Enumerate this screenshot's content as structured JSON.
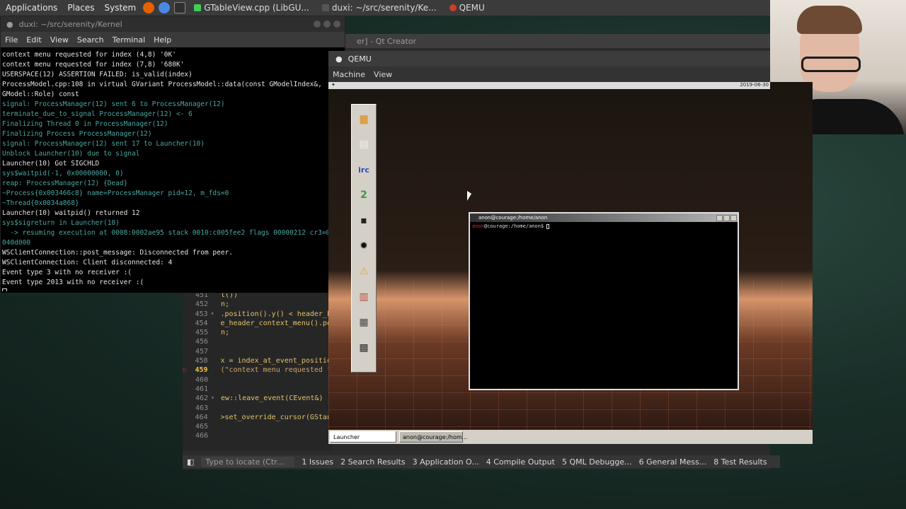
{
  "top_panel": {
    "applications": "Applications",
    "places": "Places",
    "system": "System",
    "tasks": [
      {
        "label": "GTableView.cpp (LibGU..."
      },
      {
        "label": "duxi: ~/src/serenity/Ke..."
      },
      {
        "label": "QEMU"
      }
    ],
    "colors": {
      "firefox": "#e66000",
      "chromium": "#4a88e6",
      "terminal_task": "#2f2f2f"
    }
  },
  "terminal": {
    "title": "duxi: ~/src/serenity/Kernel",
    "menu": [
      "File",
      "Edit",
      "View",
      "Search",
      "Terminal",
      "Help"
    ],
    "lines": [
      {
        "text": "context menu requested for index (4,8) '0K'",
        "style": "white"
      },
      {
        "text": "context menu requested for index (7,8) '680K'",
        "style": "white"
      },
      {
        "text": "USERSPACE(12) ASSERTION FAILED: is_valid(index)",
        "style": "white"
      },
      {
        "text": "ProcessModel.cpp:108 in virtual GVariant ProcessModel::data(const GModelIndex&,",
        "style": "white"
      },
      {
        "text": "GModel::Role) const",
        "style": "white"
      },
      {
        "text": "signal: ProcessManager(12) sent 6 to ProcessManager(12)",
        "style": "cyan"
      },
      {
        "text": "terminate_due_to_signal ProcessManager(12) <- 6",
        "style": "cyan"
      },
      {
        "text": "Finalizing Thread 0 in ProcessManager(12)",
        "style": "cyan"
      },
      {
        "text": "Finalizing Process ProcessManager(12)",
        "style": "cyan"
      },
      {
        "text": "signal: ProcessManager(12) sent 17 to Launcher(10)",
        "style": "cyan"
      },
      {
        "text": "Unblock Launcher(10) due to signal",
        "style": "cyan"
      },
      {
        "text": "Launcher(10) Got SIGCHLD",
        "style": "white"
      },
      {
        "text": "sys$waitpid(-1, 0x00000000, 0)",
        "style": "cyan"
      },
      {
        "text": "reap: ProcessManager(12) {Dead}",
        "style": "cyan"
      },
      {
        "text": "~Process{0x003466c8} name=ProcessManager pid=12, m_fds=0",
        "style": "cyan"
      },
      {
        "text": "~Thread{0x0034a868}",
        "style": "cyan"
      },
      {
        "text": "Launcher(10) waitpid() returned 12",
        "style": "white"
      },
      {
        "text": "sys$sigreturn in Launcher(10)",
        "style": "cyan"
      },
      {
        "text": "  -> resuming execution at 0008:0002ae95 stack 0010:c005fee2 flags 00000212 cr3=0",
        "style": "cyan"
      },
      {
        "text": "040d000",
        "style": "cyan"
      },
      {
        "text": "WSClientConnection::post_message: Disconnected from peer.",
        "style": "white"
      },
      {
        "text": "WSClientConnection: Client disconnected: 4",
        "style": "white"
      },
      {
        "text": "Event type 3 with no receiver :(",
        "style": "white"
      },
      {
        "text": "Event type 2013 with no receiver :(",
        "style": "white"
      }
    ]
  },
  "qtcreator": {
    "title": "er] - Qt Creator",
    "editor_lines": [
      {
        "num": "451",
        "code": "t())",
        "bp": false,
        "fold": false
      },
      {
        "num": "452",
        "code": "n;",
        "bp": false,
        "fold": false
      },
      {
        "num": "453",
        "code": ".position().y() < header_h",
        "bp": false,
        "fold": true
      },
      {
        "num": "454",
        "code": "e_header_context_menu().po",
        "bp": false,
        "fold": false
      },
      {
        "num": "455",
        "code": "n;",
        "bp": false,
        "fold": false
      },
      {
        "num": "456",
        "code": "",
        "bp": false,
        "fold": false
      },
      {
        "num": "457",
        "code": "",
        "bp": false,
        "fold": false
      },
      {
        "num": "458",
        "code": "x = index_at_event_positio",
        "bp": false,
        "fold": false
      },
      {
        "num": "459",
        "code": "(\"context menu requested f",
        "bp": true,
        "fold": false
      },
      {
        "num": "460",
        "code": "",
        "bp": false,
        "fold": false
      },
      {
        "num": "461",
        "code": "",
        "bp": false,
        "fold": false
      },
      {
        "num": "462",
        "code": "ew::leave_event(CEvent&)",
        "bp": false,
        "fold": true
      },
      {
        "num": "463",
        "code": "",
        "bp": false,
        "fold": false
      },
      {
        "num": "464",
        "code": ">set_override_cursor(GStan",
        "bp": false,
        "fold": false
      },
      {
        "num": "465",
        "code": "",
        "bp": false,
        "fold": false
      },
      {
        "num": "466",
        "code": "",
        "bp": false,
        "fold": false
      }
    ],
    "statusbar": {
      "locate_placeholder": "Type to locate (Ctr...",
      "tabs": [
        "1 Issues",
        "2 Search Results",
        "3 Application O...",
        "4 Compile Output",
        "5 QML Debugge...",
        "6 General Mess...",
        "8 Test Results"
      ]
    }
  },
  "qemu": {
    "title": "QEMU",
    "menu": [
      "Machine",
      "View"
    ],
    "clock": "2019-06-30",
    "launcher_apps": [
      {
        "icon": "folder-icon",
        "glyph": "▆",
        "color": "#d9a14a"
      },
      {
        "icon": "text-editor-icon",
        "glyph": "▤",
        "color": "#f0f0f0"
      },
      {
        "icon": "irc-icon",
        "glyph": "irc",
        "color": "#2b4fb0"
      },
      {
        "icon": "snake-icon",
        "glyph": "2",
        "color": "#3a9a3a"
      },
      {
        "icon": "terminal-icon",
        "glyph": "▪",
        "color": "#222222"
      },
      {
        "icon": "bug-icon",
        "glyph": "✹",
        "color": "#111111"
      },
      {
        "icon": "warning-icon",
        "glyph": "⚠",
        "color": "#e0b020"
      },
      {
        "icon": "books-icon",
        "glyph": "▥",
        "color": "#c04a3a"
      },
      {
        "icon": "font-editor-icon",
        "glyph": "▦",
        "color": "#444444"
      },
      {
        "icon": "calendar-icon",
        "glyph": "▩",
        "color": "#333333"
      }
    ],
    "serenity_terminal": {
      "title": "anon@courage:/home/anon",
      "prompt_user": "anon",
      "prompt_rest": "@courage:/home/anon$ "
    },
    "taskbar": {
      "launcher": "Launcher",
      "terminal": "anon@courage:/hom..."
    }
  }
}
